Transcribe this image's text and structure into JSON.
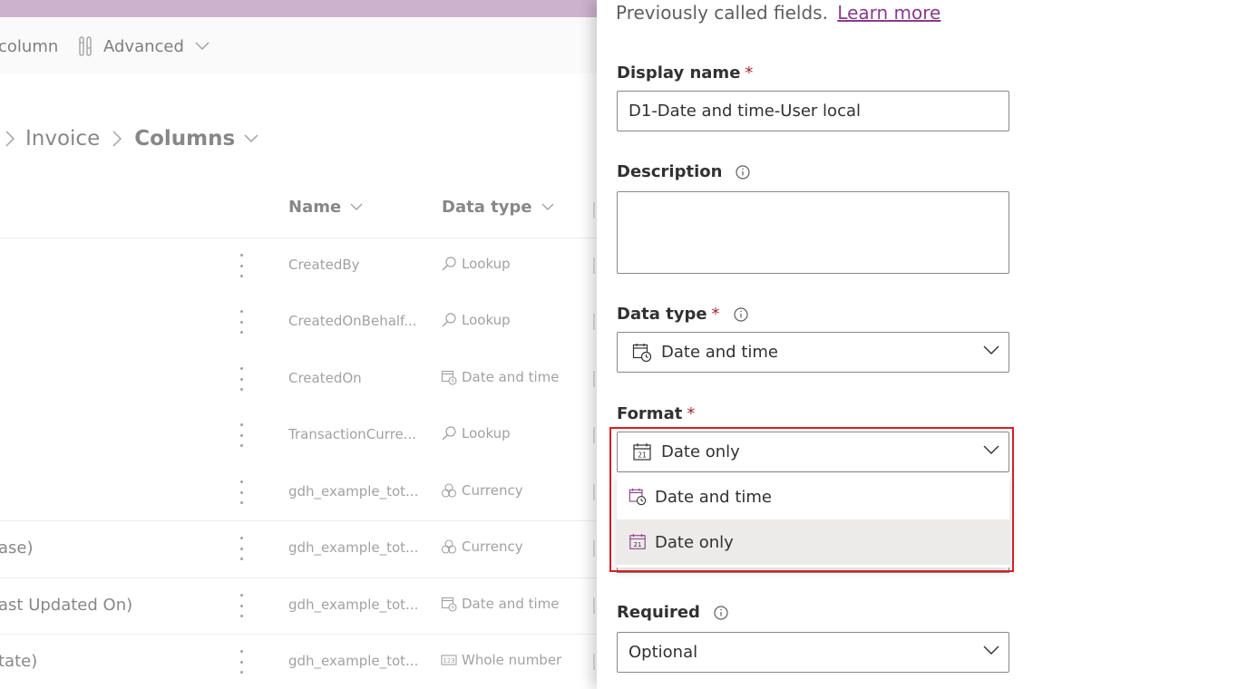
{
  "toolbar": {
    "column_label": "column",
    "advanced_label": "Advanced"
  },
  "breadcrumb": {
    "table": "Invoice",
    "current": "Columns"
  },
  "grid": {
    "headers": {
      "name": "Name",
      "data_type": "Data type"
    },
    "rows": [
      {
        "display": "",
        "name": "CreatedBy",
        "type": "Lookup",
        "icon": "lookup-icon"
      },
      {
        "display": "",
        "name": "CreatedOnBehalf...",
        "type": "Lookup",
        "icon": "lookup-icon"
      },
      {
        "display": "",
        "name": "CreatedOn",
        "type": "Date and time",
        "icon": "date-time-icon"
      },
      {
        "display": "",
        "name": "TransactionCurre...",
        "type": "Lookup",
        "icon": "lookup-icon"
      },
      {
        "display": "",
        "name": "gdh_example_tot...",
        "type": "Currency",
        "icon": "currency-icon"
      },
      {
        "display": "ase)",
        "name": "gdh_example_tot...",
        "type": "Currency",
        "icon": "currency-icon"
      },
      {
        "display": "ast Updated On)",
        "name": "gdh_example_tot...",
        "type": "Date and time",
        "icon": "date-time-icon"
      },
      {
        "display": "tate)",
        "name": "gdh_example_tot...",
        "type": "Whole number",
        "icon": "whole-number-icon"
      }
    ]
  },
  "panel": {
    "intro_text": "Previously called fields.",
    "learn_more": "Learn more",
    "display_name": {
      "label": "Display name",
      "required": "*",
      "value": "D1-Date and time-User local"
    },
    "description": {
      "label": "Description",
      "value": ""
    },
    "data_type": {
      "label": "Data type",
      "required": "*",
      "value": "Date and time"
    },
    "format": {
      "label": "Format",
      "required": "*",
      "value": "Date only",
      "options": [
        {
          "label": "Date and time",
          "selected": false
        },
        {
          "label": "Date only",
          "selected": true
        }
      ]
    },
    "required_field": {
      "label": "Required",
      "value": "Optional"
    }
  },
  "colors": {
    "top_bar": "#a97aaa",
    "link": "#8a3a8b",
    "required_asterisk": "#a4262c",
    "highlight_border": "#d41f26",
    "selected_option_bg": "#edebe9"
  }
}
